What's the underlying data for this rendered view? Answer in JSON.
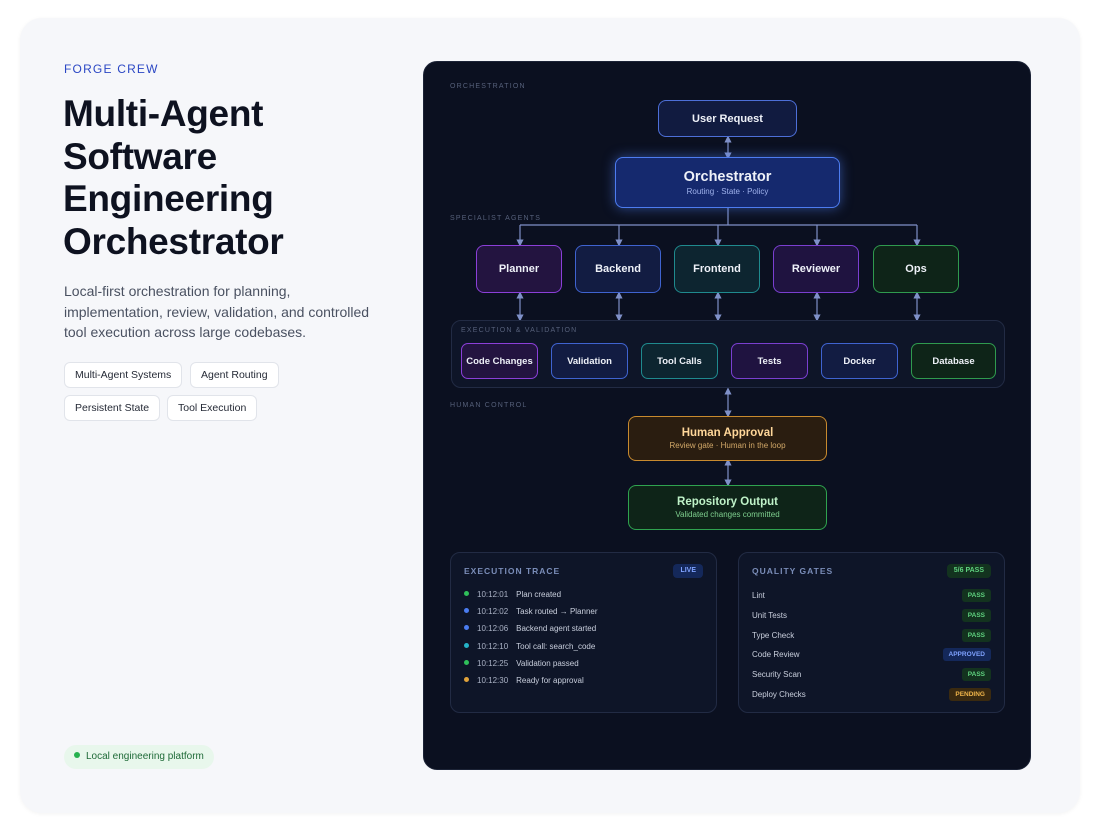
{
  "brand": {
    "eyebrow": "FORGE CREW"
  },
  "hero": {
    "title": "Multi-Agent Software Engineering Orchestrator",
    "description": "Local-first orchestration for planning, implementation, review, validation, and controlled tool execution across large codebases."
  },
  "tags": [
    "Multi-Agent Systems",
    "Agent Routing",
    "Persistent State",
    "Tool Execution"
  ],
  "status": {
    "label": "Local engineering platform",
    "color": "#26b14f"
  },
  "diagram": {
    "sections": {
      "orchestration": "ORCHESTRATION",
      "specialists": "SPECIALIST AGENTS",
      "execution": "EXECUTION & VALIDATION",
      "human": "HUMAN CONTROL"
    },
    "user_request": "User Request",
    "orchestrator": {
      "title": "Orchestrator",
      "subtitle": "Routing · State · Policy"
    },
    "agents": [
      {
        "label": "Planner",
        "color": "purple"
      },
      {
        "label": "Backend",
        "color": "blue"
      },
      {
        "label": "Frontend",
        "color": "teal"
      },
      {
        "label": "Reviewer",
        "color": "purple"
      },
      {
        "label": "Ops",
        "color": "green"
      }
    ],
    "execution_items": [
      {
        "label": "Code Changes",
        "color": "purple"
      },
      {
        "label": "Validation",
        "color": "blue"
      },
      {
        "label": "Tool Calls",
        "color": "teal"
      },
      {
        "label": "Tests",
        "color": "purple"
      },
      {
        "label": "Docker",
        "color": "blue"
      },
      {
        "label": "Database",
        "color": "green"
      }
    ],
    "human_approval": {
      "title": "Human Approval",
      "subtitle": "Review gate · Human in the loop"
    },
    "repository_output": {
      "title": "Repository Output",
      "subtitle": "Validated changes committed"
    }
  },
  "trace": {
    "title": "EXECUTION TRACE",
    "badge": "LIVE",
    "events": [
      {
        "time": "10:12:01",
        "text": "Plan created",
        "color": "#2fbf5a"
      },
      {
        "time": "10:12:02",
        "text": "Task routed → Planner",
        "color": "#4a7cf0"
      },
      {
        "time": "10:12:06",
        "text": "Backend agent started",
        "color": "#4a7cf0"
      },
      {
        "time": "10:12:10",
        "text": "Tool call: search_code",
        "color": "#25b3c8"
      },
      {
        "time": "10:12:25",
        "text": "Validation passed",
        "color": "#2fbf5a"
      },
      {
        "time": "10:12:30",
        "text": "Ready for approval",
        "color": "#e0a23a"
      }
    ]
  },
  "quality": {
    "title": "QUALITY GATES",
    "badge": "5/6 PASS",
    "gates": [
      {
        "name": "Lint",
        "status": "PASS"
      },
      {
        "name": "Unit Tests",
        "status": "PASS"
      },
      {
        "name": "Type Check",
        "status": "PASS"
      },
      {
        "name": "Code Review",
        "status": "APPROVED"
      },
      {
        "name": "Security Scan",
        "status": "PASS"
      },
      {
        "name": "Deploy Checks",
        "status": "PENDING"
      }
    ]
  }
}
